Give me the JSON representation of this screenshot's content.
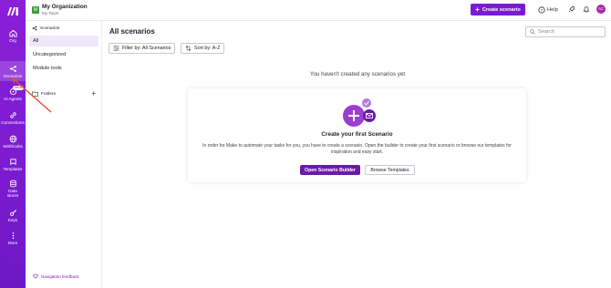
{
  "brand": {
    "logo": "make-logo",
    "accent": "#7b1bd0",
    "rail_gradient": [
      "#8a1fd6",
      "#6d17c4"
    ]
  },
  "rail": {
    "items": [
      {
        "label": "Org",
        "icon": "home-icon"
      },
      {
        "label": "Scenarios",
        "icon": "share-nodes-icon",
        "active": true
      },
      {
        "label": "AI Agents",
        "icon": "ai-agent-icon",
        "badge": "NEW"
      },
      {
        "label": "Connections",
        "icon": "link-icon"
      },
      {
        "label": "Webhooks",
        "icon": "globe-icon"
      },
      {
        "label": "Templates",
        "icon": "template-icon"
      },
      {
        "label": "Data stores",
        "icon": "database-icon"
      },
      {
        "label": "Keys",
        "icon": "key-icon"
      },
      {
        "label": "More",
        "icon": "more-vertical-icon"
      }
    ]
  },
  "org": {
    "initial": "M",
    "name": "My Organization",
    "team": "My Team"
  },
  "header": {
    "create_label": "Create scenario",
    "help_label": "Help",
    "user_initials": "AC"
  },
  "subnav": {
    "heading": "Scenarios",
    "items": [
      {
        "label": "All",
        "active": true
      },
      {
        "label": "Uncategorized"
      },
      {
        "label": "Module tools"
      }
    ],
    "folders_label": "Folders",
    "feedback_label": "Navigation feedback"
  },
  "main": {
    "title": "All scenarios",
    "search_placeholder": "Search",
    "filter_label": "Filter by: All Scenarios",
    "sort_label": "Sort by: A-Z",
    "empty_message": "You haven't created any scenarios yet",
    "card": {
      "title": "Create your first Scenario",
      "description": "In order for Make to automate your tasks for you, you have to create a scenario. Open the builder to create your first scenario or browse our templates for inspiration and easy start.",
      "primary_label": "Open Scenario Builder",
      "secondary_label": "Browse Templates"
    }
  }
}
